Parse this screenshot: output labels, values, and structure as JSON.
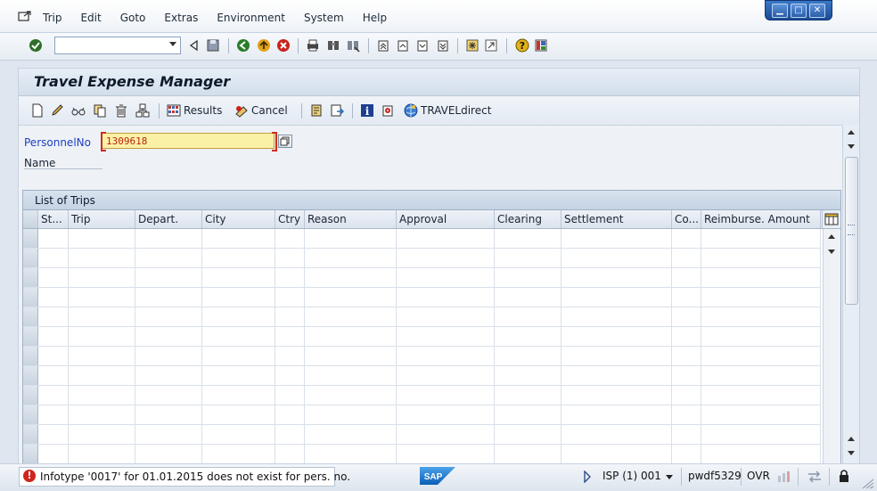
{
  "menubar": {
    "items": [
      "Trip",
      "Edit",
      "Goto",
      "Extras",
      "Environment",
      "System",
      "Help"
    ]
  },
  "window_controls": [
    "minimize",
    "maximize",
    "close"
  ],
  "std_toolbar": {
    "command_field_value": "",
    "icons": [
      "enter-icon",
      "back-icon",
      "save-icon",
      "back-green-icon",
      "exit-icon",
      "cancel-icon",
      "print-icon",
      "find-icon",
      "find-next-icon",
      "first-page-icon",
      "previous-page-icon",
      "next-page-icon",
      "last-page-icon",
      "create-session-icon",
      "shortcut-icon",
      "help-icon",
      "customize-layout-icon"
    ]
  },
  "screen": {
    "title": "Travel Expense Manager"
  },
  "app_toolbar": {
    "results_label": "Results",
    "cancel_label": "Cancel",
    "traveldirect_label": "TRAVELdirect"
  },
  "form": {
    "personnel_label": "PersonnelNo",
    "personnel_value": "1309618",
    "name_label": "Name"
  },
  "trips_table": {
    "title": "List of Trips",
    "columns": [
      "St...",
      "Trip",
      "Depart.",
      "City",
      "Ctry",
      "Reason",
      "Approval",
      "Clearing",
      "Settlement",
      "Co...",
      "Reimburse. Amount"
    ],
    "rows": []
  },
  "statusbar": {
    "message": "Infotype '0017' for 01.01.2015 does not exist for pers. no.",
    "system": "ISP (1) 001",
    "server": "pwdf5329",
    "mode": "OVR",
    "logo": "SAP"
  },
  "colors": {
    "highlight_field": "#fbf1a6",
    "label_blue": "#1d3ec2",
    "error_red": "#d0241c"
  }
}
